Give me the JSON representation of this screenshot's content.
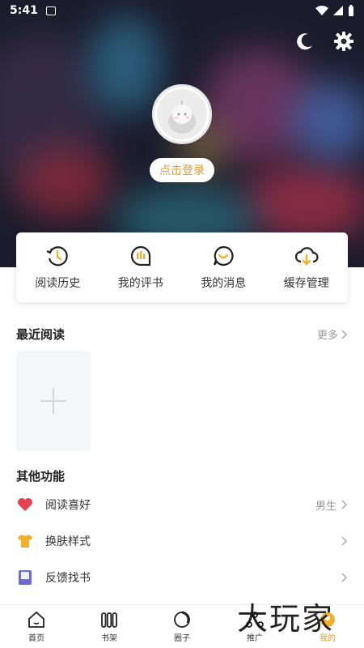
{
  "status": {
    "time": "5:41"
  },
  "header": {
    "night_mode_icon": "moon-icon",
    "settings_icon": "gear-icon",
    "login_label": "点击登录"
  },
  "quick_actions": [
    {
      "label": "阅读历史",
      "icon": "history-icon"
    },
    {
      "label": "我的评书",
      "icon": "comment-bars-icon"
    },
    {
      "label": "我的消息",
      "icon": "message-icon"
    },
    {
      "label": "缓存管理",
      "icon": "cloud-download-icon"
    }
  ],
  "recent": {
    "title": "最近阅读",
    "more_label": "更多"
  },
  "other": {
    "title": "其他功能",
    "items": [
      {
        "label": "阅读喜好",
        "value": "男生",
        "icon": "heart-icon"
      },
      {
        "label": "换肤样式",
        "value": "",
        "icon": "shirt-icon"
      },
      {
        "label": "反馈找书",
        "value": "",
        "icon": "book-icon"
      }
    ]
  },
  "bottom_nav": [
    {
      "label": "首页",
      "icon": "home-icon"
    },
    {
      "label": "书架",
      "icon": "bookshelf-icon"
    },
    {
      "label": "圈子",
      "icon": "circle-icon"
    },
    {
      "label": "推广",
      "icon": "share-icon"
    },
    {
      "label": "我的",
      "icon": "profile-icon"
    }
  ],
  "colors": {
    "accent": "#e29b2b",
    "background": "#ffffff"
  },
  "watermark": "大玩家"
}
